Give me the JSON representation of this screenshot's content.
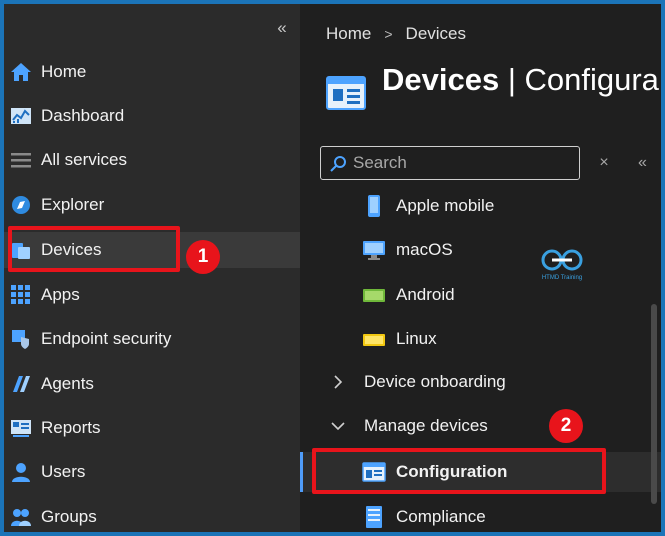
{
  "nav": {
    "collapse_glyph": "«",
    "items": [
      {
        "label": "Home",
        "icon": "home-icon"
      },
      {
        "label": "Dashboard",
        "icon": "dashboard-icon"
      },
      {
        "label": "All services",
        "icon": "all-services-icon"
      },
      {
        "label": "Explorer",
        "icon": "explorer-icon"
      },
      {
        "label": "Devices",
        "icon": "devices-icon"
      },
      {
        "label": "Apps",
        "icon": "apps-icon"
      },
      {
        "label": "Endpoint security",
        "icon": "endpoint-security-icon"
      },
      {
        "label": "Agents",
        "icon": "agents-icon"
      },
      {
        "label": "Reports",
        "icon": "reports-icon"
      },
      {
        "label": "Users",
        "icon": "users-icon"
      },
      {
        "label": "Groups",
        "icon": "groups-icon"
      }
    ],
    "selected": "Devices"
  },
  "breadcrumb": {
    "home": "Home",
    "separator": ">",
    "current": "Devices"
  },
  "page": {
    "title_main": "Devices",
    "title_sep": " | ",
    "title_sub": "Configura"
  },
  "search": {
    "placeholder": "Search",
    "clear_glyph": "×",
    "collapse_glyph": "«"
  },
  "menu": {
    "platform_items": [
      {
        "label": "Apple mobile",
        "icon": "apple-mobile-icon"
      },
      {
        "label": "macOS",
        "icon": "macos-icon"
      },
      {
        "label": "Android",
        "icon": "android-icon"
      },
      {
        "label": "Linux",
        "icon": "linux-icon"
      }
    ],
    "groups": [
      {
        "label": "Device onboarding",
        "expanded": false
      },
      {
        "label": "Manage devices",
        "expanded": true
      }
    ],
    "manage_items": [
      {
        "label": "Configuration",
        "icon": "configuration-icon",
        "active": true
      },
      {
        "label": "Compliance",
        "icon": "compliance-icon",
        "active": false
      }
    ]
  },
  "annotations": {
    "badge_1": "1",
    "badge_2": "2",
    "color": "#e8141b"
  },
  "watermark": {
    "text": "HTMD Training"
  },
  "colors": {
    "accent": "#4f9cf9",
    "frame": "#1b74b8",
    "nav_bg": "#2b2b2b",
    "blade_bg": "#1f1f1f"
  }
}
